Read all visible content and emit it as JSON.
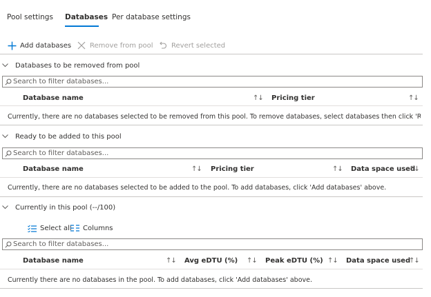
{
  "tabs": [
    {
      "label": "Pool settings"
    },
    {
      "label": "Databases"
    },
    {
      "label": "Per database settings"
    }
  ],
  "toolbar": {
    "add_label": "Add databases",
    "remove_label": "Remove from pool",
    "revert_label": "Revert selected"
  },
  "section_remove": {
    "title": "Databases to be removed from pool",
    "search_placeholder": "Search to filter databases...",
    "columns": [
      "Database name",
      "Pricing tier"
    ],
    "empty_message": "Currently, there are no databases selected to be removed from this pool. To remove databases, select databases then click 'Re..."
  },
  "section_ready": {
    "title": "Ready to be added to this pool",
    "search_placeholder": "Search to filter databases...",
    "columns": [
      "Database name",
      "Pricing tier",
      "Data space used"
    ],
    "empty_message": "Currently, there are no databases selected to be added to the pool. To add databases, click 'Add databases' above."
  },
  "section_current": {
    "title": "Currently in this pool (--/100)",
    "select_all_label": "Select all",
    "columns_label": "Columns",
    "search_placeholder": "Search to filter databases...",
    "columns": [
      "Database name",
      "Avg eDTU (%)",
      "Peak eDTU (%)",
      "Data space used"
    ],
    "empty_message": "Currently there are no databases in the pool. To add databases, click 'Add databases' above."
  },
  "sort_glyph": "↑↓",
  "colors": {
    "accent": "#0078d4",
    "text": "#323130",
    "disabled": "#a19f9d",
    "border": "#8a8886",
    "divider": "#c8c6c4"
  },
  "icons": [
    "plus-icon",
    "close-icon",
    "undo-icon",
    "chevron-down-icon",
    "search-icon",
    "select-all-icon",
    "columns-icon"
  ]
}
